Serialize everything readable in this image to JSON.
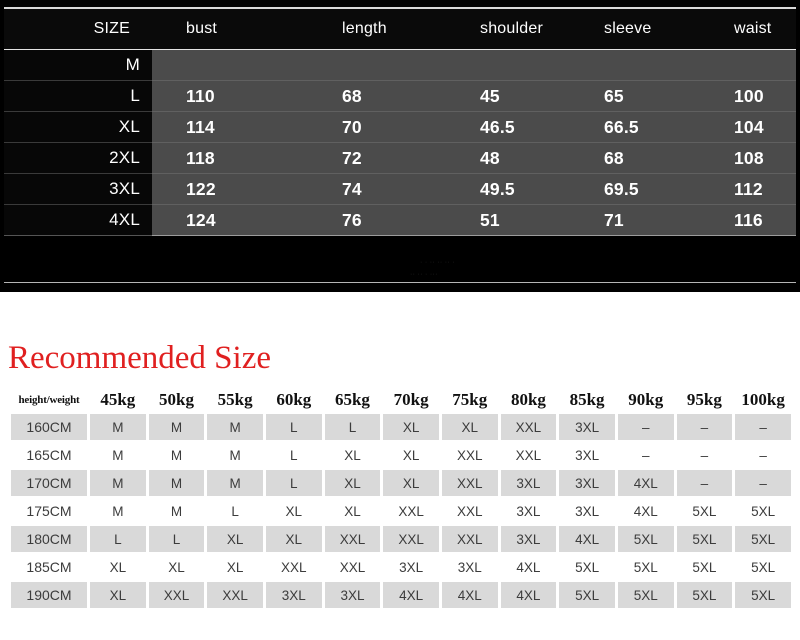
{
  "spec_table": {
    "columns": [
      "SIZE",
      "bust",
      "length",
      "shoulder",
      "sleeve",
      "waist"
    ],
    "rows": [
      {
        "size": "M",
        "bust": "",
        "length": "",
        "shoulder": "",
        "sleeve": "",
        "waist": ""
      },
      {
        "size": "L",
        "bust": "110",
        "length": "68",
        "shoulder": "45",
        "sleeve": "65",
        "waist": "100"
      },
      {
        "size": "XL",
        "bust": "114",
        "length": "70",
        "shoulder": "46.5",
        "sleeve": "66.5",
        "waist": "104"
      },
      {
        "size": "2XL",
        "bust": "118",
        "length": "72",
        "shoulder": "48",
        "sleeve": "68",
        "waist": "108"
      },
      {
        "size": "3XL",
        "bust": "122",
        "length": "74",
        "shoulder": "49.5",
        "sleeve": "69.5",
        "waist": "112"
      },
      {
        "size": "4XL",
        "bust": "124",
        "length": "76",
        "shoulder": "51",
        "sleeve": "71",
        "waist": "116"
      }
    ]
  },
  "recommended": {
    "title": "Recommended Size",
    "title_color": "#e02020",
    "corner_label": "height/weight",
    "weight_columns": [
      "45kg",
      "50kg",
      "55kg",
      "60kg",
      "65kg",
      "70kg",
      "75kg",
      "80kg",
      "85kg",
      "90kg",
      "95kg",
      "100kg"
    ],
    "rows": [
      {
        "height": "160CM",
        "sizes": [
          "M",
          "M",
          "M",
          "L",
          "L",
          "XL",
          "XL",
          "XXL",
          "3XL",
          "–",
          "–",
          "–"
        ]
      },
      {
        "height": "165CM",
        "sizes": [
          "M",
          "M",
          "M",
          "L",
          "XL",
          "XL",
          "XXL",
          "XXL",
          "3XL",
          "–",
          "–",
          "–"
        ]
      },
      {
        "height": "170CM",
        "sizes": [
          "M",
          "M",
          "M",
          "L",
          "XL",
          "XL",
          "XXL",
          "3XL",
          "3XL",
          "4XL",
          "–",
          "–"
        ]
      },
      {
        "height": "175CM",
        "sizes": [
          "M",
          "M",
          "L",
          "XL",
          "XL",
          "XXL",
          "XXL",
          "3XL",
          "3XL",
          "4XL",
          "5XL",
          "5XL"
        ]
      },
      {
        "height": "180CM",
        "sizes": [
          "L",
          "L",
          "XL",
          "XL",
          "XXL",
          "XXL",
          "XXL",
          "3XL",
          "4XL",
          "5XL",
          "5XL",
          "5XL"
        ]
      },
      {
        "height": "185CM",
        "sizes": [
          "XL",
          "XL",
          "XL",
          "XXL",
          "XXL",
          "3XL",
          "3XL",
          "4XL",
          "5XL",
          "5XL",
          "5XL",
          "5XL"
        ]
      },
      {
        "height": "190CM",
        "sizes": [
          "XL",
          "XXL",
          "XXL",
          "3XL",
          "3XL",
          "4XL",
          "4XL",
          "4XL",
          "5XL",
          "5XL",
          "5XL",
          "5XL"
        ]
      }
    ]
  }
}
